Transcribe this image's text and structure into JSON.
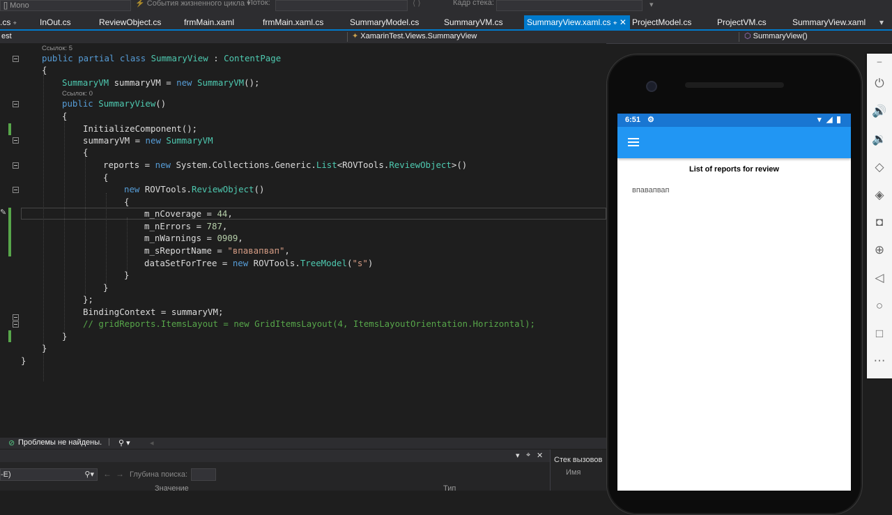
{
  "toolbar": {
    "process_field": "[] Mono",
    "lifecycle_events": "События жизненного цикла",
    "thread_label": "Поток:",
    "stack_frame_label": "Кадр стека:"
  },
  "tabs": [
    {
      "label": ".cs"
    },
    {
      "label": "InOut.cs"
    },
    {
      "label": "ReviewObject.cs"
    },
    {
      "label": "frmMain.xaml"
    },
    {
      "label": "frmMain.xaml.cs"
    },
    {
      "label": "SummaryModel.cs"
    },
    {
      "label": "SummaryVM.cs"
    },
    {
      "label": "SummaryView.xaml.cs",
      "active": true
    },
    {
      "label": "ProjectModel.cs"
    },
    {
      "label": "ProjectVM.cs"
    },
    {
      "label": "SummaryView.xaml"
    }
  ],
  "nav": {
    "project": "est",
    "type": "XamarinTest.Views.SummaryView",
    "member": "SummaryView()"
  },
  "code": {
    "refs_class": "Ссылок: 5",
    "refs_ctor": "Ссылок: 0"
  },
  "status": {
    "problems": "Проблемы не найдены."
  },
  "lower_panel": {
    "search_value": "-E)",
    "search_depth_label": "Глубина поиска:",
    "col_value": "Значение",
    "col_type": "Тип"
  },
  "callstack": {
    "title": "Стек вызовов",
    "col_name": "Имя"
  },
  "phone": {
    "time": "6:51",
    "page_title": "List of reports for review",
    "item_text": "впавапвап"
  },
  "colors": {
    "accent": "#007acc",
    "app_bar": "#2196f3",
    "status_bar": "#1976d2"
  }
}
